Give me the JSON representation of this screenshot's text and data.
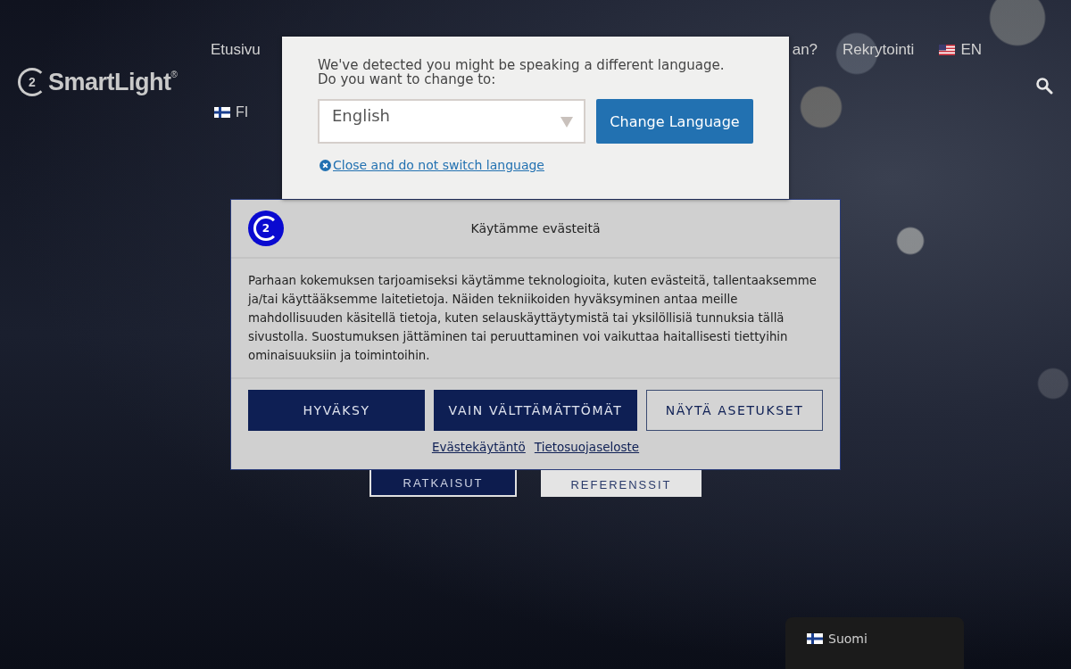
{
  "header": {
    "logo": {
      "mark": "2",
      "name": "SmartLight",
      "registered": "®"
    },
    "nav": [
      {
        "label": "Etusivu",
        "kind": "link"
      },
      {
        "label": "an?",
        "kind": "link"
      },
      {
        "label": "Rekrytointi",
        "kind": "link"
      },
      {
        "label": "EN",
        "kind": "language"
      }
    ],
    "language": {
      "label": "FI"
    }
  },
  "hero_buttons": [
    {
      "label": "RATKAISUT",
      "kind": "primary"
    },
    {
      "label": "REFERENSSIT",
      "kind": "secondary"
    }
  ],
  "language_popup": {
    "message": "We've detected you might be speaking a different language.\nDo you want to change to:",
    "select_value": "English",
    "button": "Change Language",
    "close_link": "Close and do not switch language"
  },
  "cookie_dialog": {
    "logo_mark": "2",
    "title": "Käytämme evästeitä",
    "body": "Parhaan kokemuksen tarjoamiseksi käytämme teknologioita, kuten evästeitä, tallentaaksemme ja/tai käyttääksemme laitetietoja. Näiden tekniikoiden hyväksyminen antaa meille mahdollisuuden käsitellä tietoja, kuten selauskäyttäytymistä tai yksilöllisiä tunnuksia tällä sivustolla. Suostumuksen jättäminen tai peruuttaminen voi vaikuttaa haitallisesti tiettyihin ominaisuuksiin ja toimintoihin.",
    "buttons": [
      {
        "label": "HYVÄKSY",
        "kind": "primary"
      },
      {
        "label": "VAIN VÄLTTÄMÄTTÖMÄT",
        "kind": "primary"
      },
      {
        "label": "NÄYTÄ ASETUKSET",
        "kind": "outline"
      }
    ],
    "links": [
      "Evästekäytäntö",
      "Tietosuojaseloste"
    ]
  },
  "language_switcher": {
    "label": "Suomi"
  }
}
